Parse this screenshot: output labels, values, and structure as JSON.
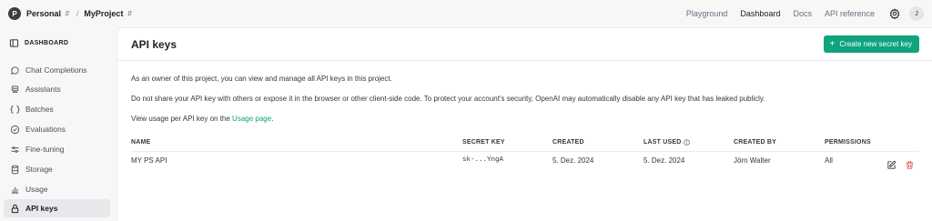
{
  "topbar": {
    "org_initial": "P",
    "org_name": "Personal",
    "separator": "/",
    "project_name": "MyProject",
    "nav": [
      "Playground",
      "Dashboard",
      "Docs",
      "API reference"
    ],
    "active_nav": "Dashboard",
    "user_initial": "J",
    "icons": [
      "chevron-updown-icon",
      "gear-icon"
    ]
  },
  "sidebar": {
    "header": "DASHBOARD",
    "items": [
      {
        "label": "Chat Completions",
        "icon": "chat-bubble-icon"
      },
      {
        "label": "Assistants",
        "icon": "assistant-icon"
      },
      {
        "label": "Batches",
        "icon": "batches-icon"
      },
      {
        "label": "Evaluations",
        "icon": "evaluations-icon"
      },
      {
        "label": "Fine-tuning",
        "icon": "sliders-icon"
      },
      {
        "label": "Storage",
        "icon": "database-icon"
      },
      {
        "label": "Usage",
        "icon": "bar-chart-icon"
      },
      {
        "label": "API keys",
        "icon": "lock-icon",
        "active": true
      }
    ]
  },
  "main": {
    "title": "API keys",
    "create_button": "Create new secret key",
    "paragraphs": {
      "p1": "As an owner of this project, you can view and manage all API keys in this project.",
      "p2": "Do not share your API key with others or expose it in the browser or other client-side code. To protect your account's security, OpenAI may automatically disable any API key that has leaked publicly.",
      "p3_prefix": "View usage per API key on the ",
      "p3_link": "Usage page",
      "p3_suffix": "."
    },
    "table": {
      "columns": [
        "NAME",
        "SECRET KEY",
        "CREATED",
        "LAST USED",
        "CREATED BY",
        "PERMISSIONS"
      ],
      "rows": [
        {
          "name": "MY PS API",
          "secret_key": "sk-...YngA",
          "created": "5. Dez. 2024",
          "last_used": "5. Dez. 2024",
          "created_by": "Jörn Walter",
          "permissions": "All"
        }
      ]
    }
  },
  "colors": {
    "accent": "#10a37f",
    "danger": "#d9534f",
    "sidebar_bg": "#f7f7f8",
    "active_item_bg": "#e8e8ec"
  }
}
